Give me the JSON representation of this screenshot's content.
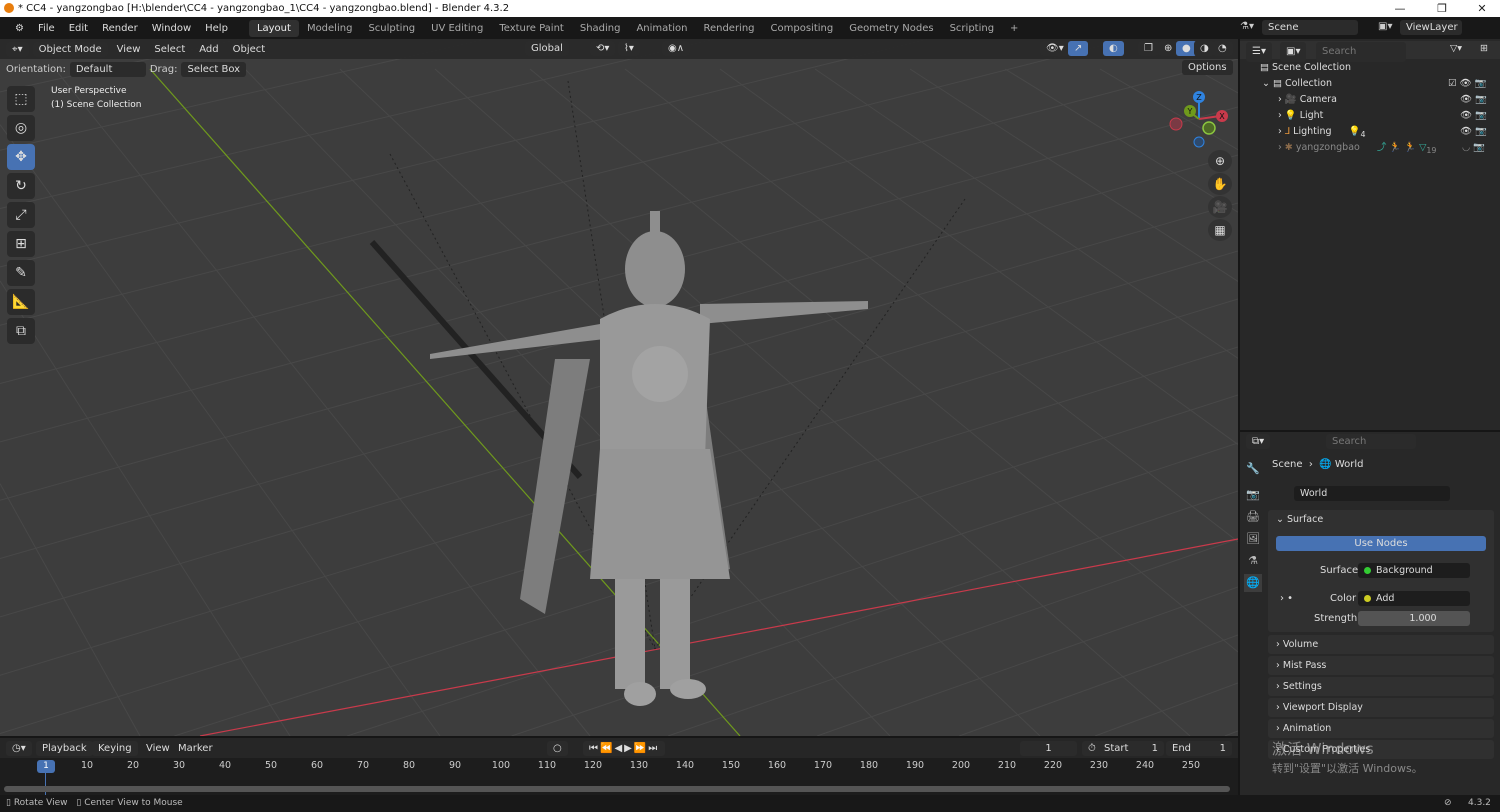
{
  "window": {
    "title": "* CC4 - yangzongbao [H:\\blender\\CC4 - yangzongbao_1\\CC4 - yangzongbao.blend] - Blender 4.3.2",
    "min": "—",
    "max": "❐",
    "close": "✕"
  },
  "menus": [
    "File",
    "Edit",
    "Render",
    "Window",
    "Help"
  ],
  "workspaces": [
    "Layout",
    "Modeling",
    "Sculpting",
    "UV Editing",
    "Texture Paint",
    "Shading",
    "Animation",
    "Rendering",
    "Compositing",
    "Geometry Nodes",
    "Scripting",
    "+"
  ],
  "active_workspace": "Layout",
  "scene": {
    "name": "Scene",
    "view_layer": "ViewLayer"
  },
  "viewport": {
    "mode": "Object Mode",
    "menus": [
      "View",
      "Select",
      "Add",
      "Object"
    ],
    "transform_orientation": "Global",
    "orientation_label": "Orientation:",
    "orientation": "Default",
    "drag_label": "Drag:",
    "drag": "Select Box",
    "options": "Options",
    "overlay_line1": "User Perspective",
    "overlay_line2": "(1) Scene Collection",
    "gizmo": {
      "x": "X",
      "y": "Y",
      "z": "Z"
    },
    "colors": {
      "x": "#c93a4b",
      "y": "#6f9a1c",
      "z": "#2f83e0",
      "grid": "#484848",
      "background": "#3d3d3d"
    }
  },
  "tools": [
    "select-box",
    "cursor",
    "move",
    "rotate",
    "scale",
    "transform",
    "annotate",
    "measure",
    "add-cube"
  ],
  "outliner": {
    "search_placeholder": "Search",
    "scene_collection": "Scene Collection",
    "collection": "Collection",
    "items": [
      {
        "name": "Camera",
        "color": "#e8973b"
      },
      {
        "name": "Light",
        "color": "#e8973b"
      },
      {
        "name": "Lighting",
        "color": "#e8973b",
        "badge": "4"
      },
      {
        "name": "yangzongbao",
        "color": "#8a6a4a",
        "badge": "19"
      }
    ]
  },
  "properties": {
    "search_placeholder": "Search",
    "breadcrumb": [
      "Scene",
      "World"
    ],
    "world_name": "World",
    "surface_panel": "Surface",
    "use_nodes": "Use Nodes",
    "surface_label": "Surface",
    "surface_value": "Background",
    "color_label": "Color",
    "color_value": "Add",
    "strength_label": "Strength",
    "strength_value": "1.000",
    "panels": [
      "Volume",
      "Mist Pass",
      "Settings",
      "Viewport Display",
      "Animation",
      "Custom Properties"
    ]
  },
  "timeline": {
    "menus": [
      "Playback",
      "Keying",
      "View",
      "Marker"
    ],
    "current_frame": "1",
    "start_label": "Start",
    "start": "1",
    "end_label": "End",
    "end": "1",
    "ticks": [
      "10",
      "20",
      "30",
      "40",
      "50",
      "60",
      "70",
      "80",
      "90",
      "100",
      "110",
      "120",
      "130",
      "140",
      "150",
      "160",
      "170",
      "180",
      "190",
      "200",
      "210",
      "220",
      "230",
      "240",
      "250"
    ],
    "playhead": "1"
  },
  "status": {
    "left1": "Rotate View",
    "left2": "Center View to Mouse",
    "version": "4.3.2"
  },
  "watermark": {
    "line1": "激活 Windows",
    "line2": "转到\"设置\"以激活 Windows。"
  }
}
